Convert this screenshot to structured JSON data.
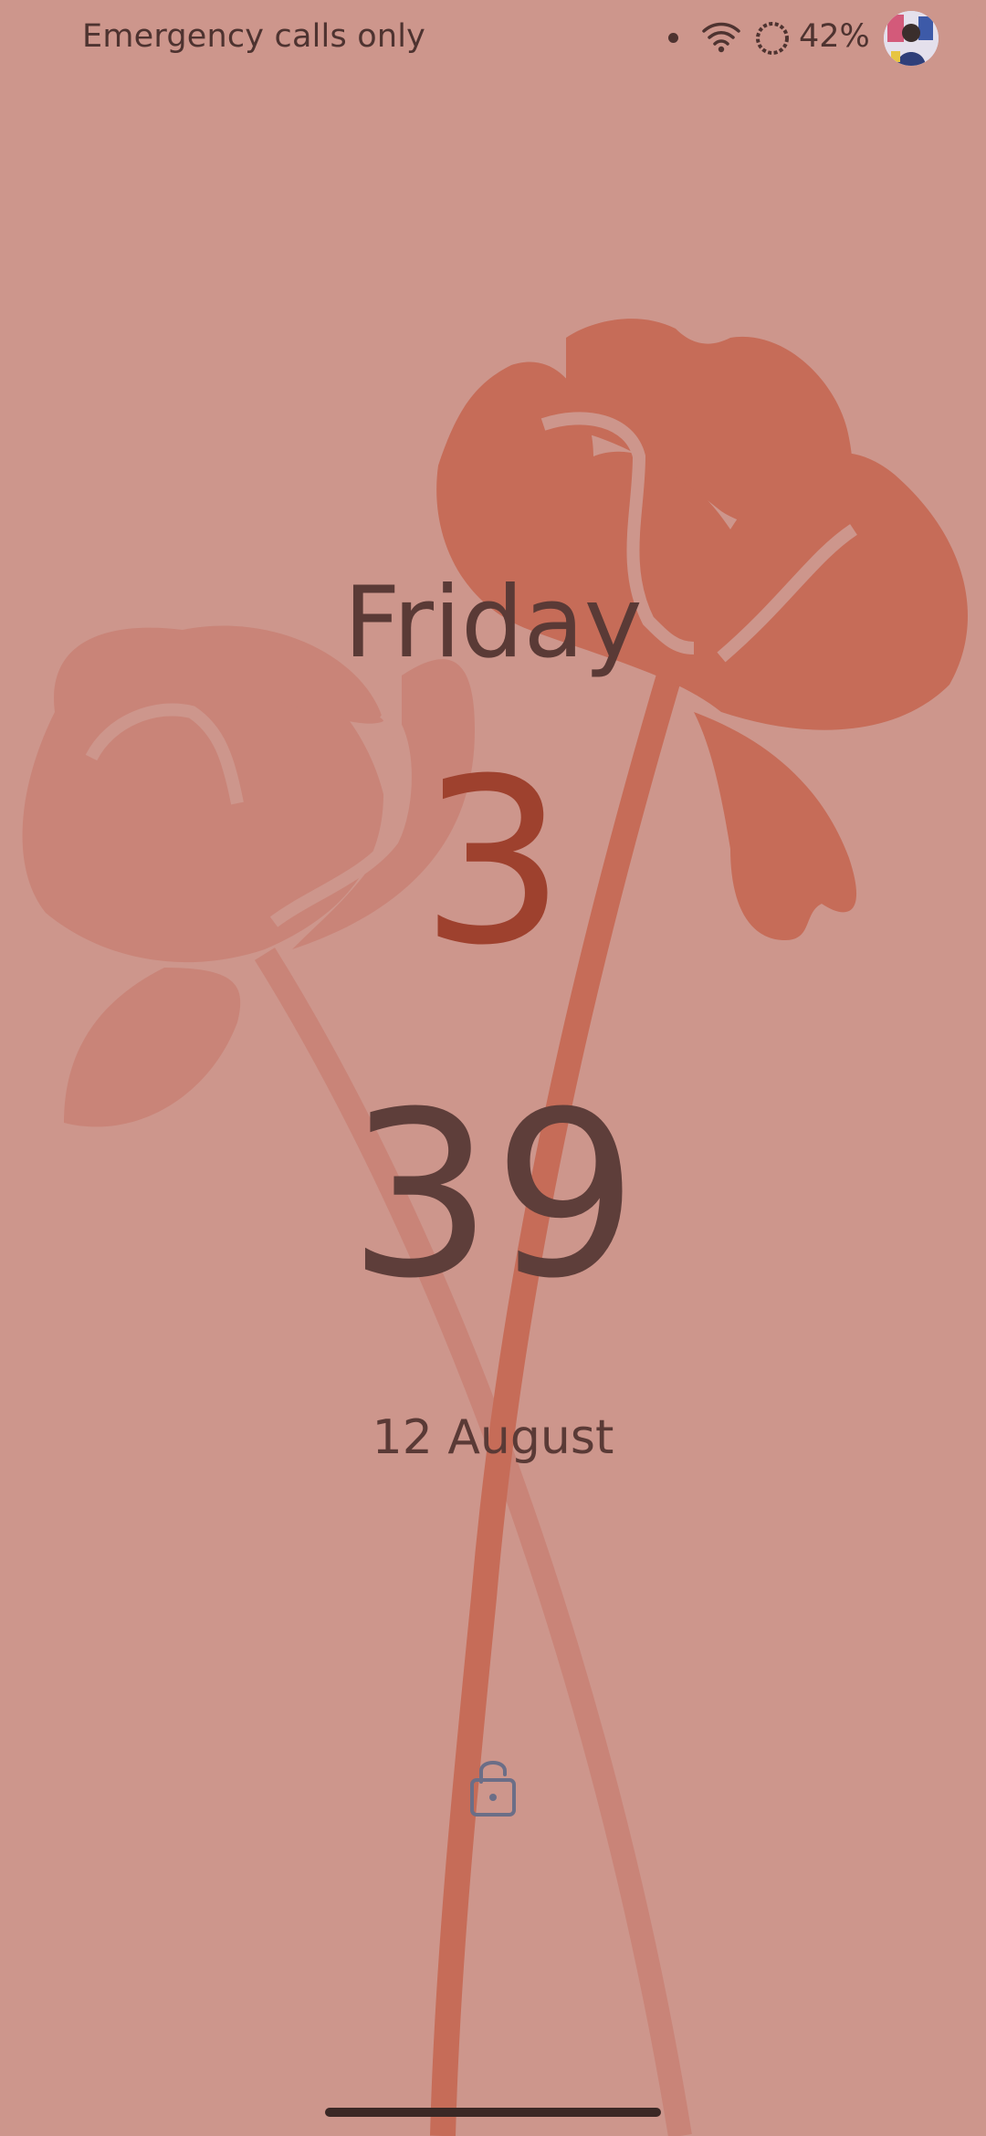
{
  "status_bar": {
    "carrier_text": "Emergency calls only",
    "battery_text": "42%",
    "icons": [
      "notification-dot-icon",
      "wifi-icon",
      "battery-saver-icon",
      "avatar"
    ]
  },
  "lockscreen": {
    "day": "Friday",
    "hour": "3",
    "minute": "39",
    "date": "12 August",
    "lock_icon": "lock-icon"
  },
  "colors": {
    "background": "#cd968c",
    "flower_front": "#c66c58",
    "flower_back": "#c98478",
    "hour_accent": "#9e412e",
    "text": "#5a3a36"
  }
}
